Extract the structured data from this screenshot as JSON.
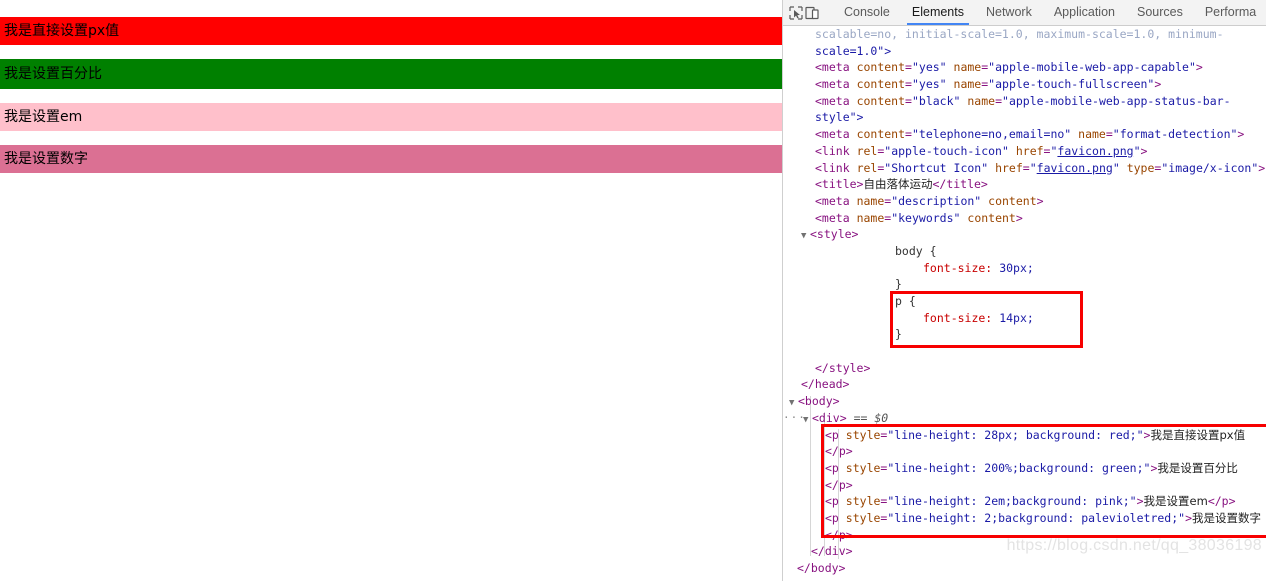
{
  "page": {
    "title": "自由落体运动",
    "paragraphs": [
      {
        "text": "我是直接设置px值",
        "background": "#ff0000",
        "line_height": "28px",
        "style_label": "line-height: 28px; background: red;"
      },
      {
        "text": "我是设置百分比",
        "background": "#008000",
        "line_height": "200%",
        "style_label": "line-height: 200%;background: green;"
      },
      {
        "text": "我是设置em",
        "background": "#ffc0cb",
        "line_height": "2em",
        "style_label": "line-height: 2em;background: pink;"
      },
      {
        "text": "我是设置数字",
        "background": "#db7093",
        "line_height": "2",
        "style_label": "line-height: 2;background: palevioletred;"
      }
    ]
  },
  "devtools": {
    "icons": {
      "inspect": "inspect-element-icon",
      "device": "device-toolbar-icon"
    },
    "tabs": [
      {
        "label": "Console",
        "active": false
      },
      {
        "label": "Elements",
        "active": true
      },
      {
        "label": "Network",
        "active": false
      },
      {
        "label": "Application",
        "active": false
      },
      {
        "label": "Sources",
        "active": false
      },
      {
        "label": "Performa",
        "active": false
      }
    ],
    "watermark": "https://blog.csdn.net/qq_38036198",
    "code": {
      "l01a": "scalable=no, initial-scale=1.0, maximum-scale=1.0, minimum-",
      "l01b": "scale=1.0\">",
      "l02_tag": "<meta",
      "l02_attr1": "content",
      "l02_v1": "\"yes\"",
      "l02_attr2": "name",
      "l02_v2": "\"apple-mobile-web-app-capable\"",
      "l03_v1": "\"yes\"",
      "l03_v2": "\"apple-touch-fullscreen\"",
      "l04_v1": "\"black\"",
      "l04_v2": "\"apple-mobile-web-app-status-bar-",
      "l04_cont": "style\">",
      "l05_v1": "\"telephone=no,email=no\"",
      "l05_v2": "\"format-detection\"",
      "l06_tag": "<link",
      "l06_attr1": "rel",
      "l06_v1": "\"apple-touch-icon\"",
      "l06_attr2": "href",
      "l06_link": "favicon.png",
      "l07_v1": "\"Shortcut Icon\"",
      "l07_link": "favicon.png",
      "l07_attr3": "type",
      "l07_v3": "\"image/x-icon\"",
      "l08_open": "<title>",
      "l08_text": "自由落体运动",
      "l08_close": "</title>",
      "l09_attr": "name",
      "l09_v": "\"description\"",
      "l09_attr2": "content",
      "l10_v": "\"keywords\"",
      "l11_style_open": "<style>",
      "l12": "body {",
      "l13_prop": "font-size:",
      "l13_val": "30px;",
      "l14": "}",
      "l15": "p {",
      "l16_prop": "font-size:",
      "l16_val": "14px;",
      "l17": "}",
      "l18_style_close": "</style>",
      "l19_head_close": "</head>",
      "l20_body_open": "<body>",
      "l21_div_open": "<div>",
      "l21_ref": "== $0",
      "l22_tag": "<p",
      "l22_attr": "style",
      "l22_val": "\"line-height: 28px; background: red;\"",
      "l22_text": "我是直接设置px值",
      "l23_close": "</p>",
      "l24_val": "\"line-height: 200%;background: green;\"",
      "l24_text": "我是设置百分比",
      "l25_close": "</p>",
      "l26_val": "\"line-height: 2em;background: pink;\"",
      "l26_text": "我是设置em",
      "l26_close": "</p>",
      "l27_val": "\"line-height: 2;background: palevioletred;\"",
      "l27_text": "我是设置数字",
      "l28_close": "</p>",
      "l29_div_close": "</div>",
      "l30_body_close": "</body>",
      "ellipsis": "···"
    }
  }
}
